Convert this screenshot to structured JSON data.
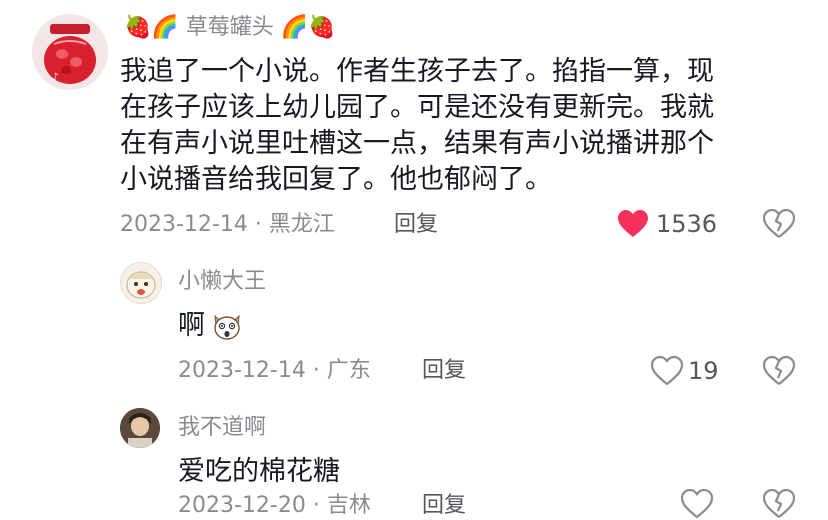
{
  "comment": {
    "username_prefix": "🍓🌈",
    "username_text": "草莓罐头",
    "username_suffix": "🌈🍓",
    "lines": [
      "我追了一个小说。作者生孩子去了。掐指一算，现",
      "在孩子应该上幼儿园了。可是还没有更新完。我就",
      "在有声小说里吐槽这一点，结果有声小说播讲那个",
      "小说播音给我回复了。他也郁闷了。"
    ],
    "date_location": "2023-12-14 · 黑龙江",
    "reply_label": "回复",
    "like_count": "1536",
    "liked_color": "#f5305a"
  },
  "replies": [
    {
      "username": "小懒大王",
      "text": "啊",
      "date_location": "2023-12-14 · 广东",
      "reply_label": "回复",
      "like_count": "19"
    },
    {
      "username": "我不道啊",
      "text": "爱吃的棉花糖",
      "date_location": "2023-12-20 · 吉林",
      "reply_label": "回复"
    }
  ]
}
